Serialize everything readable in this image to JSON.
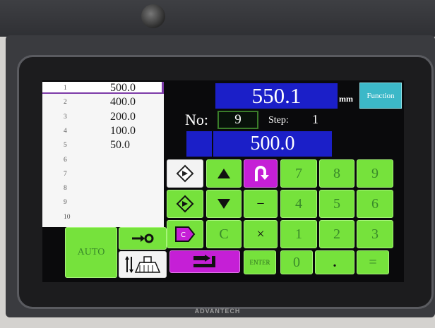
{
  "list": {
    "rows": [
      {
        "num": "1",
        "value": "500.0"
      },
      {
        "num": "2",
        "value": "400.0"
      },
      {
        "num": "3",
        "value": "200.0"
      },
      {
        "num": "4",
        "value": "100.0"
      },
      {
        "num": "5",
        "value": "50.0"
      },
      {
        "num": "6",
        "value": ""
      },
      {
        "num": "7",
        "value": ""
      },
      {
        "num": "8",
        "value": ""
      },
      {
        "num": "9",
        "value": ""
      },
      {
        "num": "10",
        "value": ""
      }
    ]
  },
  "display": {
    "position": "550.1",
    "unit": "mm",
    "function_label": "Function",
    "no_label": "No:",
    "no_value": "9",
    "step_label": "Step:",
    "step_value": "1",
    "set_value": "500.0"
  },
  "keypad": {
    "auto": "AUTO",
    "clear": "C",
    "multiply": "×",
    "minus": "−",
    "enter": "ENTER",
    "k7": "7",
    "k8": "8",
    "k9": "9",
    "k4": "4",
    "k5": "5",
    "k6": "6",
    "k1": "1",
    "k2": "2",
    "k3": "3",
    "k0": "0",
    "dot": ".",
    "equals": "="
  },
  "device": {
    "brand": "ADVANTECH"
  },
  "colors": {
    "key_green": "#76e23c",
    "display_blue": "#1b1fc8",
    "accent_purple": "#c51fd6",
    "function_teal": "#3cb8c8"
  },
  "icons": [
    "program-edit-icon",
    "up-arrow-icon",
    "undo-icon",
    "program-insert-icon",
    "down-arrow-icon",
    "sequence-icon",
    "backgauge-icon",
    "clamp-adjust-icon",
    "advance-icon"
  ]
}
